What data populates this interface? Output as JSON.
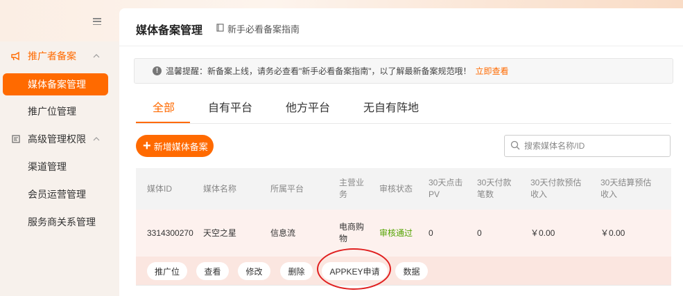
{
  "sidebar": {
    "groups": [
      {
        "label": "推广者备案",
        "items": [
          "媒体备案管理",
          "推广位管理"
        ]
      },
      {
        "label": "高级管理权限",
        "items": [
          "渠道管理",
          "会员运营管理",
          "服务商关系管理"
        ]
      }
    ]
  },
  "header": {
    "title": "媒体备案管理",
    "guide_link": "新手必看备案指南"
  },
  "notice": {
    "text": "温馨提醒：新备案上线，请务必查看\"新手必看备案指南\"，以了解最新备案规范哦！",
    "link": "立即查看"
  },
  "tabs": [
    "全部",
    "自有平台",
    "他方平台",
    "无自有阵地"
  ],
  "toolbar": {
    "add_label": "新增媒体备案",
    "search_placeholder": "搜索媒体名称/ID"
  },
  "table": {
    "columns": [
      "媒体ID",
      "媒体名称",
      "所属平台",
      "主营业务",
      "审核状态",
      "30天点击PV",
      "30天付款笔数",
      "30天付款预估收入",
      "30天结算预估收入"
    ],
    "rows": [
      {
        "id": "3314300270",
        "name": "天空之星",
        "platform": "信息流",
        "business": "电商购物",
        "status": "审核通过",
        "pv": "0",
        "orders": "0",
        "pay_income": "￥0.00",
        "settle_income": "￥0.00",
        "actions": [
          "推广位",
          "查看",
          "修改",
          "删除",
          "APPKEY申请",
          "数据"
        ]
      }
    ]
  },
  "colors": {
    "accent": "#ff6a00",
    "status_pass": "#52a300",
    "annotation": "#e02020"
  }
}
